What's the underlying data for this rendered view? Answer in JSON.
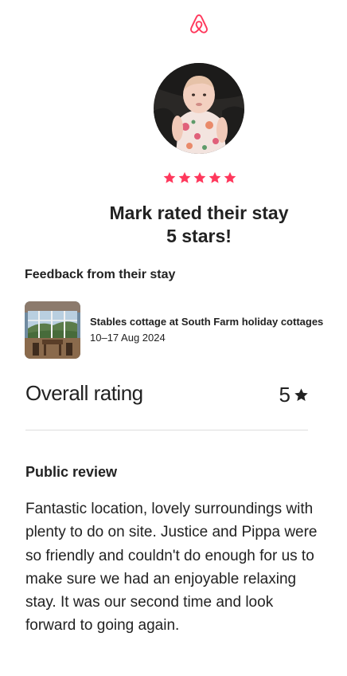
{
  "brand": {
    "logo_icon": "airbnb-belo-icon",
    "accent_color": "#FF385C"
  },
  "guest": {
    "avatar_icon": "guest-avatar-photo",
    "rating_stars": 5,
    "headline_line1": "Mark rated their stay",
    "headline_line2": "5 stars!"
  },
  "feedback": {
    "title": "Feedback from their stay",
    "listing_name": "Stables cottage at South Farm holiday cottages",
    "listing_dates": "10–17 Aug 2024",
    "listing_thumb_icon": "listing-photo"
  },
  "overall": {
    "label": "Overall rating",
    "value": "5",
    "star_icon": "star-icon"
  },
  "review": {
    "title": "Public review",
    "text": "Fantastic location, lovely surroundings with plenty to do on site. Justice and Pippa were so friendly and couldn't do enough for us to make sure we had an enjoyable relaxing stay. It was our second time and look forward to going again."
  }
}
